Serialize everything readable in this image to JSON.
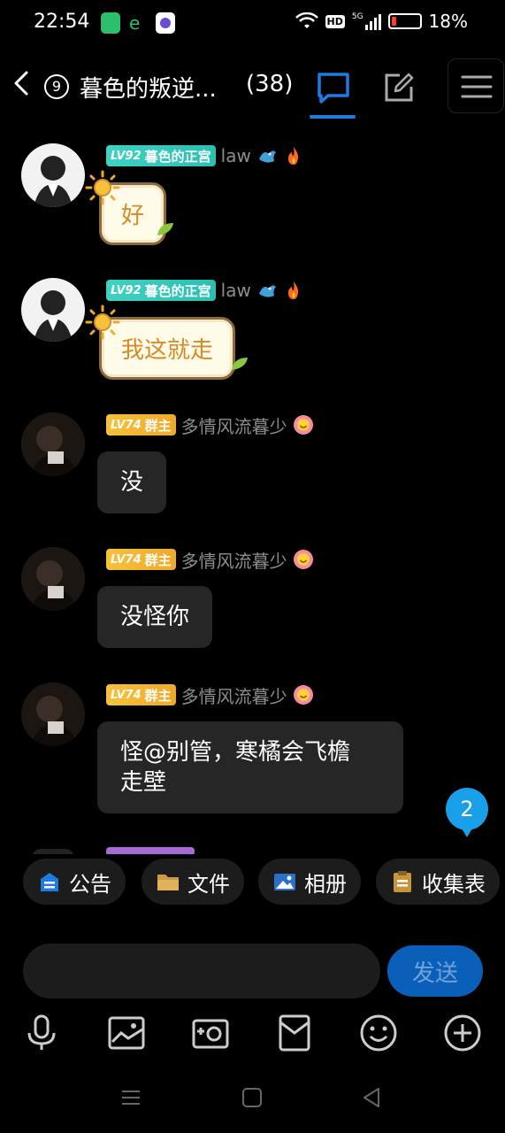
{
  "status_bar": {
    "time": "22:54",
    "network": "5G",
    "hd_label": "HD",
    "battery": "18%",
    "battery_level": 0.18
  },
  "header": {
    "group_badge": "9",
    "title": "暮色的叛逆...",
    "member_count": "(38)"
  },
  "messages": [
    {
      "level": "LV92",
      "title_tag": "暮色的正宫",
      "name": "law",
      "text": "好",
      "style": "fancy"
    },
    {
      "level": "LV92",
      "title_tag": "暮色的正宫",
      "name": "law",
      "text": "我这就走",
      "style": "fancy"
    },
    {
      "level": "LV74",
      "title_tag": "群主",
      "name": "多情风流暮少",
      "text": "没",
      "style": "dark"
    },
    {
      "level": "LV74",
      "title_tag": "群主",
      "name": "多情风流暮少",
      "text": "没怪你",
      "style": "dark"
    },
    {
      "level": "LV74",
      "title_tag": "群主",
      "name": "多情风流暮少",
      "text_line1": "怪@别管，寒橘会飞檐",
      "text_line2": "走壁",
      "style": "dark"
    }
  ],
  "unread_count": "2",
  "quick_bar": {
    "notice": "公告",
    "files": "文件",
    "album": "相册",
    "form": "收集表"
  },
  "input": {
    "placeholder": "",
    "send_label": "发送"
  },
  "colors": {
    "accent": "#1e7be0",
    "teal_tag": "#3fd2c2",
    "gold_tag": "#f6c23a",
    "bubble_dark": "#262626",
    "unread_badge": "#1aa0e8"
  }
}
